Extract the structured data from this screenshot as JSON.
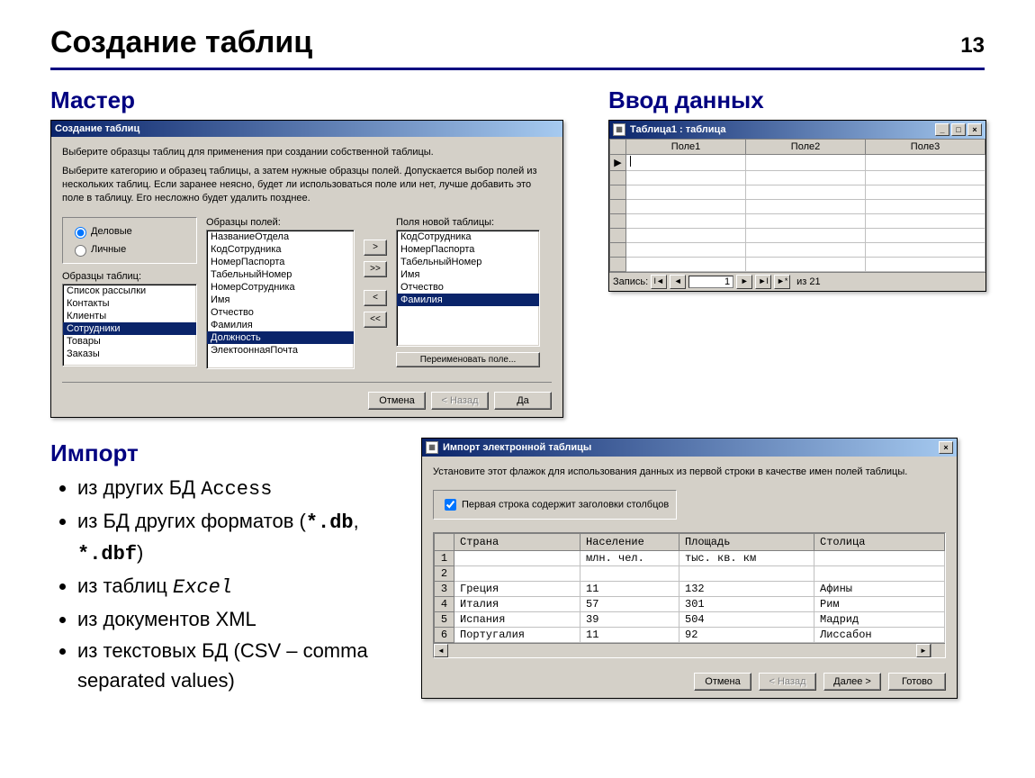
{
  "page": {
    "title": "Создание таблиц",
    "number": "13"
  },
  "sections": {
    "wizard": "Мастер",
    "dataentry": "Ввод данных",
    "import": "Импорт"
  },
  "wizard_dialog": {
    "title": "Создание таблиц",
    "intro1": "Выберите образцы таблиц для применения при создании собственной таблицы.",
    "intro2": "Выберите категорию и образец таблицы, а затем нужные образцы полей. Допускается выбор полей из нескольких таблиц. Если заранее неясно, будет ли использоваться поле или нет, лучше добавить это поле в таблицу. Его несложно будет удалить позднее.",
    "radio_business": "Деловые",
    "radio_personal": "Личные",
    "label_samples": "Образцы таблиц:",
    "label_fields": "Образцы полей:",
    "label_newfields": "Поля новой таблицы:",
    "sample_tables": [
      "Список рассылки",
      "Контакты",
      "Клиенты",
      "Сотрудники",
      "Товары",
      "Заказы"
    ],
    "sample_tables_selected": "Сотрудники",
    "sample_fields": [
      "НазваниеОтдела",
      "КодСотрудника",
      "НомерПаспорта",
      "ТабельныйНомер",
      "НомерСотрудника",
      "Имя",
      "Отчество",
      "Фамилия",
      "Должность",
      "ЭлектооннаяПочта"
    ],
    "sample_fields_selected": "Должность",
    "new_fields": [
      "КодСотрудника",
      "НомерПаспорта",
      "ТабельныйНомер",
      "Имя",
      "Отчество",
      "Фамилия"
    ],
    "new_fields_selected": "Фамилия",
    "btn_rename": "Переименовать поле...",
    "btn_cancel": "Отмена",
    "btn_back": "< Назад",
    "btn_next": "Да"
  },
  "datasheet_window": {
    "title": "Таблица1 : таблица",
    "columns": [
      "Поле1",
      "Поле2",
      "Поле3"
    ],
    "record_label": "Запись:",
    "record_num": "1",
    "record_total": "из 21"
  },
  "import_dialog": {
    "title": "Импорт электронной таблицы",
    "instruction": "Установите этот флажок для использования данных из первой строки в качестве имен полей таблицы.",
    "checkbox_label": "Первая строка содержит заголовки столбцов",
    "columns": [
      "Страна",
      "Население",
      "Площадь",
      "Столица"
    ],
    "row_units": [
      "",
      "млн. чел.",
      "тыс. кв. км",
      ""
    ],
    "rows": [
      [
        "Греция",
        "11",
        "132",
        "Афины"
      ],
      [
        "Италия",
        "57",
        "301",
        "Рим"
      ],
      [
        "Испания",
        "39",
        "504",
        "Мадрид"
      ],
      [
        "Португалия",
        "11",
        "92",
        "Лиссабон"
      ]
    ],
    "btn_cancel": "Отмена",
    "btn_back": "< Назад",
    "btn_next": "Далее >",
    "btn_finish": "Готово"
  },
  "import_list": {
    "item1_a": "из других БД ",
    "item1_b": "Access",
    "item2_a": "из БД других форматов (",
    "item2_b": "*.db",
    "item2_c": ", ",
    "item2_d": "*.dbf",
    "item2_e": ")",
    "item3_a": "из таблиц ",
    "item3_b": "Excel",
    "item4": "из документов XML",
    "item5": "из текстовых БД (CSV – comma separated values)"
  },
  "move_buttons": {
    "one_right": ">",
    "all_right": ">>",
    "one_left": "<",
    "all_left": "<<"
  }
}
